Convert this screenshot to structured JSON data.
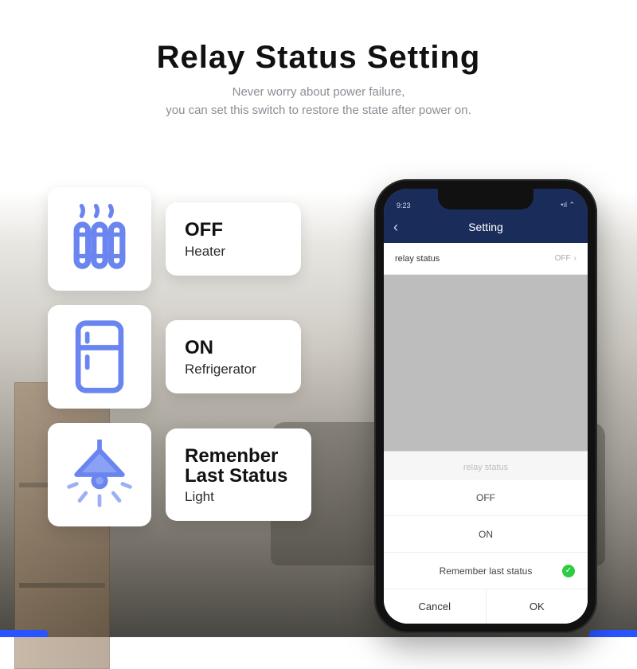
{
  "header": {
    "title": "Relay  Status  Setting",
    "subtitle_line1": "Never worry about power failure,",
    "subtitle_line2": "you can set this switch to restore the state after power on."
  },
  "cards": {
    "heater": {
      "label": "OFF",
      "sublabel": "Heater"
    },
    "fridge": {
      "label": "ON",
      "sublabel": "Refrigerator"
    },
    "light": {
      "label_line1": "Remenber",
      "label_line2": "Last Status",
      "sublabel": "Light"
    }
  },
  "phone": {
    "status_time": "9:23",
    "nav_title": "Setting",
    "row_label": "relay status",
    "row_value": "OFF",
    "sheet": {
      "title": "relay status",
      "options": [
        "OFF",
        "ON",
        "Remember last status"
      ],
      "selected_index": 2,
      "cancel": "Cancel",
      "ok": "OK"
    }
  }
}
